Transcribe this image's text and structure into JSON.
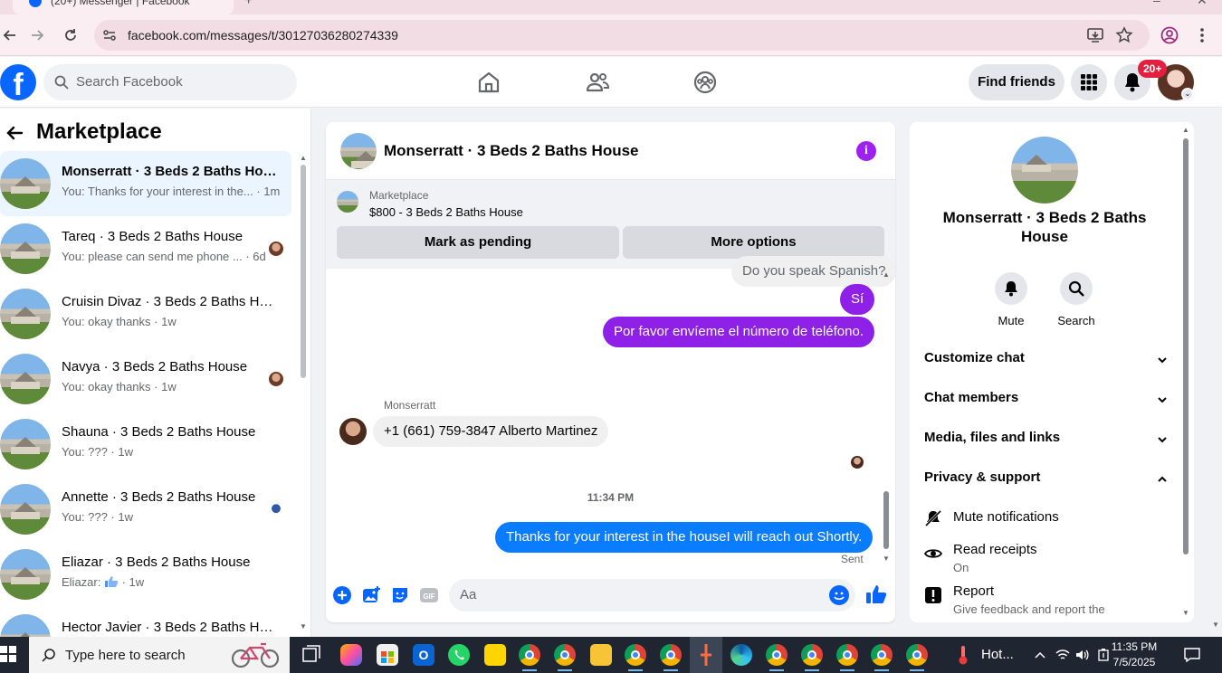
{
  "browser": {
    "tab_title": "(20+) Messenger | Facebook",
    "url": "facebook.com/messages/t/30127036280274339"
  },
  "header": {
    "search_placeholder": "Search Facebook",
    "find_friends": "Find friends",
    "notification_badge": "20+"
  },
  "sidebar": {
    "title": "Marketplace",
    "chats": [
      {
        "name": "Monserratt · 3 Beds 2 Baths House",
        "preview": "You: Thanks for your interest in the...",
        "time": "1m",
        "active": true,
        "read_avatar": "none"
      },
      {
        "name": "Tareq · 3 Beds 2 Baths House",
        "preview": "You: please can send me phone ...",
        "time": "6d",
        "active": false,
        "read_avatar": "person"
      },
      {
        "name": "Cruisin Divaz · 3 Beds 2 Baths House",
        "preview": "You: okay thanks",
        "time": "1w",
        "active": false,
        "read_avatar": "none"
      },
      {
        "name": "Navya · 3 Beds 2 Baths House",
        "preview": "You: okay thanks",
        "time": "1w",
        "active": false,
        "read_avatar": "person"
      },
      {
        "name": "Shauna · 3 Beds 2 Baths House",
        "preview": "You: ???",
        "time": "1w",
        "active": false,
        "read_avatar": "none"
      },
      {
        "name": "Annette · 3 Beds 2 Baths House",
        "preview": "You: ???",
        "time": "1w",
        "active": false,
        "read_avatar": "blue"
      },
      {
        "name": "Eliazar · 3 Beds 2 Baths House",
        "preview": "Eliazar:",
        "time": "1w",
        "active": false,
        "read_avatar": "none",
        "preview_icon": "thumbs-up-icon"
      },
      {
        "name": "Hector Javier · 3 Beds 2 Baths House",
        "preview": "",
        "time": "",
        "active": false,
        "read_avatar": "none"
      }
    ]
  },
  "conversation": {
    "title": "Monserratt · 3 Beds 2 Baths House",
    "marketplace_label": "Marketplace",
    "listing": "$800 - 3 Beds 2 Baths House",
    "mark_pending": "Mark as pending",
    "more_options": "More options",
    "messages": {
      "partial_in": "Do you speak Spanish?",
      "out_1": "Sí",
      "out_2": "Por favor envíeme el número de teléfono.",
      "sender_name": "Monserratt",
      "in_1": "+1 (661) 759-3847 Alberto Martinez",
      "timestamp": "11:34 PM",
      "out_3": "Thanks for your interest in the houseI will reach out Shortly.",
      "sent_status": "Sent"
    },
    "composer_placeholder": "Aa"
  },
  "info_panel": {
    "name": "Monserratt · 3 Beds 2 Baths House",
    "mute_label": "Mute",
    "search_label": "Search",
    "sections": {
      "customize": "Customize chat",
      "members": "Chat members",
      "media": "Media, files and links",
      "privacy": "Privacy & support"
    },
    "items": {
      "mute_notifications": "Mute notifications",
      "read_receipts": "Read receipts",
      "read_receipts_status": "On",
      "report": "Report",
      "report_sub": "Give feedback and report the"
    }
  },
  "taskbar": {
    "search_placeholder": "Type here to search",
    "weather": "Hot...",
    "time": "11:35 PM",
    "date": "7/5/2025"
  },
  "colors": {
    "fb_blue": "#0866ff",
    "purple_bubble": "#8e20e8",
    "blue_bubble": "#0a7cff",
    "active_chat": "#ebf5ff"
  }
}
